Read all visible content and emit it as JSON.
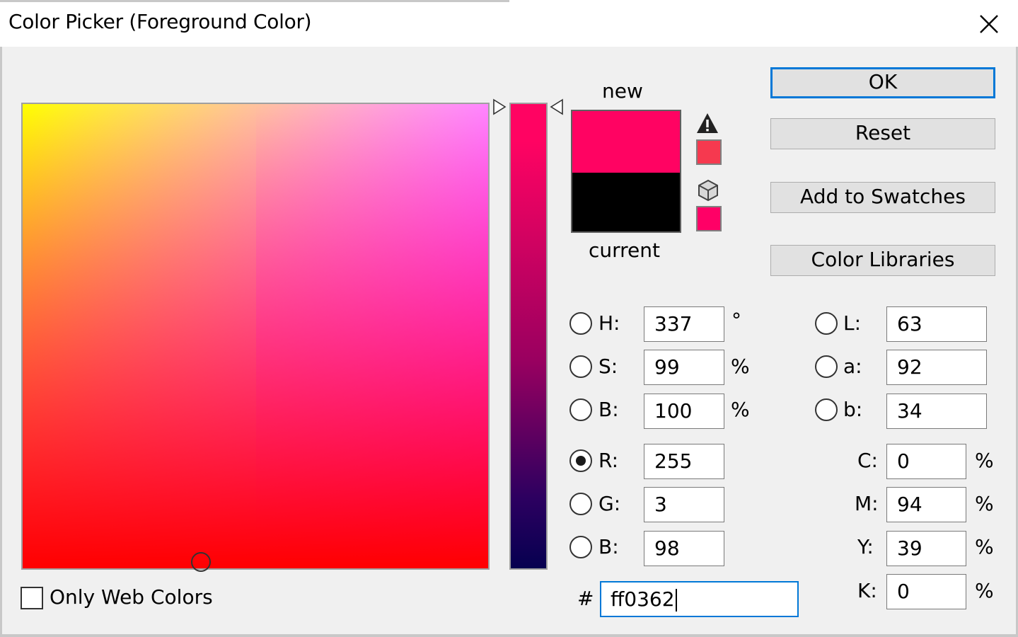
{
  "window": {
    "title": "Color Picker (Foreground Color)",
    "close_icon": "close-icon"
  },
  "colors": {
    "new": "#ff0362",
    "current": "#000000",
    "gamut_warning_swatch": "#f6394f",
    "web_safe_swatch": "#ff0066",
    "accent": "#0078d7"
  },
  "labels": {
    "new": "new",
    "current": "current"
  },
  "buttons": {
    "ok": "OK",
    "reset": "Reset",
    "add_to_swatches": "Add to Swatches",
    "color_libraries": "Color Libraries"
  },
  "hsb": {
    "h_label": "H:",
    "h_value": "337",
    "h_unit": "°",
    "s_label": "S:",
    "s_value": "99",
    "s_unit": "%",
    "b_label": "B:",
    "b_value": "100",
    "b_unit": "%"
  },
  "rgb": {
    "r_label": "R:",
    "r_value": "255",
    "g_label": "G:",
    "g_value": "3",
    "b_label": "B:",
    "b_value": "98",
    "selected": "R"
  },
  "lab": {
    "l_label": "L:",
    "l_value": "63",
    "a_label": "a:",
    "a_value": "92",
    "b_label": "b:",
    "b_value": "34"
  },
  "cmyk": {
    "c_label": "C:",
    "c_value": "0",
    "c_unit": "%",
    "m_label": "M:",
    "m_value": "94",
    "m_unit": "%",
    "y_label": "Y:",
    "y_value": "39",
    "y_unit": "%",
    "k_label": "K:",
    "k_value": "0",
    "k_unit": "%"
  },
  "hex": {
    "label": "#",
    "value": "ff0362"
  },
  "only_web_colors": {
    "label": "Only Web Colors",
    "checked": false
  },
  "icons": {
    "gamut_warning": "warning-icon",
    "web_safe": "cube-icon"
  }
}
